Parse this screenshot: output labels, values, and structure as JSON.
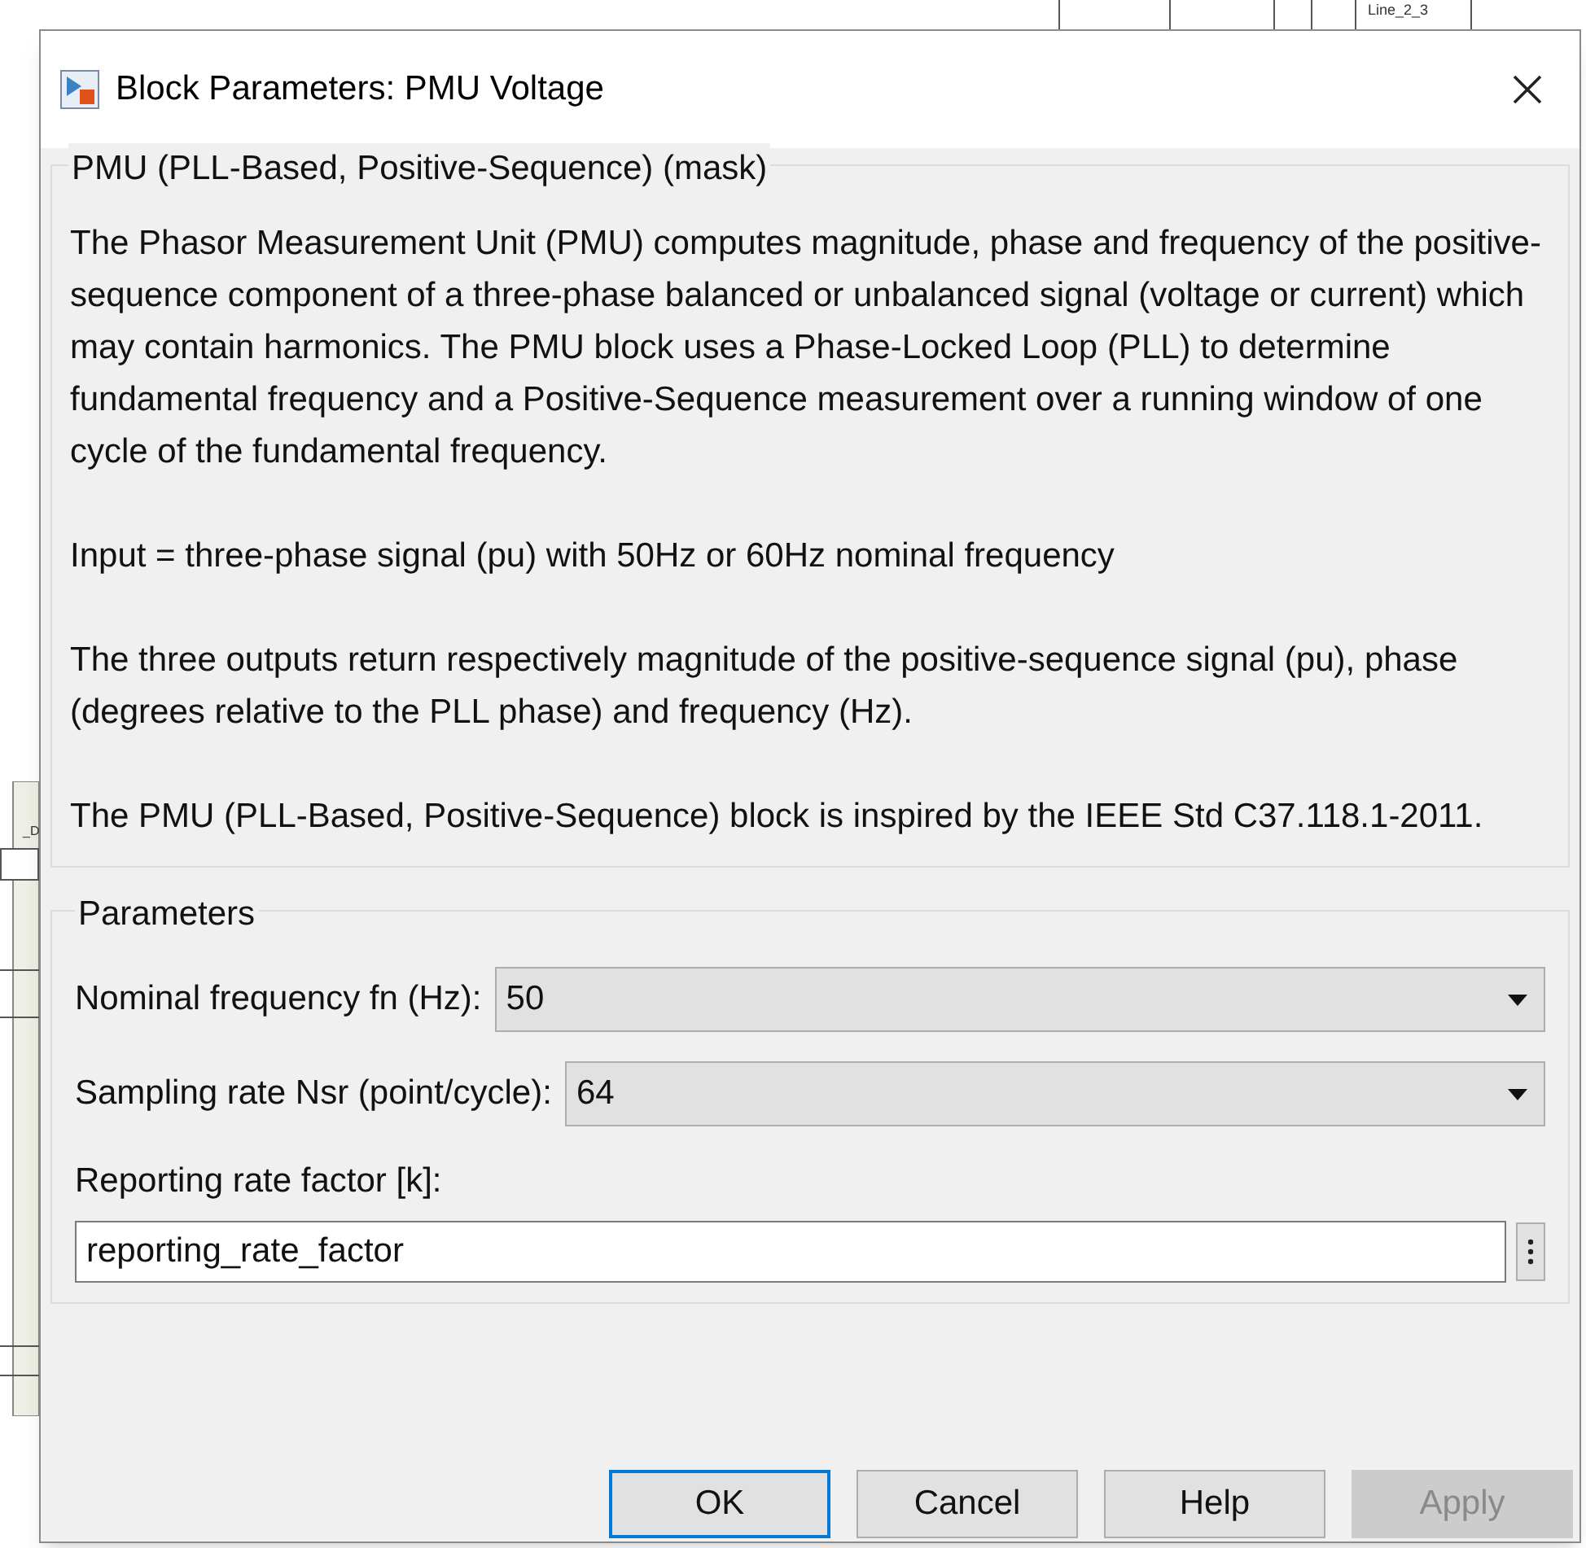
{
  "canvas": {
    "labels": [
      "Line_2_3",
      "_D"
    ]
  },
  "window": {
    "title": "Block Parameters: PMU Voltage"
  },
  "description": {
    "title": "PMU (PLL-Based, Positive-Sequence) (mask)",
    "paragraphs": [
      "The Phasor Measurement Unit (PMU) computes magnitude, phase and frequency of the positive-sequence component of a three-phase balanced or unbalanced signal (voltage or current) which may contain harmonics. The PMU block uses a Phase-Locked Loop (PLL) to determine fundamental frequency and a Positive-Sequence measurement over a running window of one cycle of the fundamental frequency.",
      "Input = three-phase signal (pu) with 50Hz or 60Hz nominal frequency",
      "The three outputs return respectively magnitude of the positive-sequence signal (pu), phase (degrees relative to the PLL phase) and frequency (Hz).",
      "The PMU (PLL-Based, Positive-Sequence) block is inspired by the IEEE Std C37.118.1-2011."
    ]
  },
  "parameters": {
    "title": "Parameters",
    "items": [
      {
        "kind": "dropdown",
        "label": "Nominal frequency fn (Hz):",
        "value": "50"
      },
      {
        "kind": "dropdown",
        "label": "Sampling rate Nsr (point/cycle):",
        "value": "64"
      },
      {
        "kind": "text",
        "label": "Reporting rate factor [k]:",
        "value": "reporting_rate_factor"
      }
    ]
  },
  "buttons": [
    {
      "label": "OK",
      "focused": true,
      "disabled": false
    },
    {
      "label": "Cancel",
      "focused": false,
      "disabled": false
    },
    {
      "label": "Help",
      "focused": false,
      "disabled": false
    },
    {
      "label": "Apply",
      "focused": false,
      "disabled": true
    }
  ]
}
